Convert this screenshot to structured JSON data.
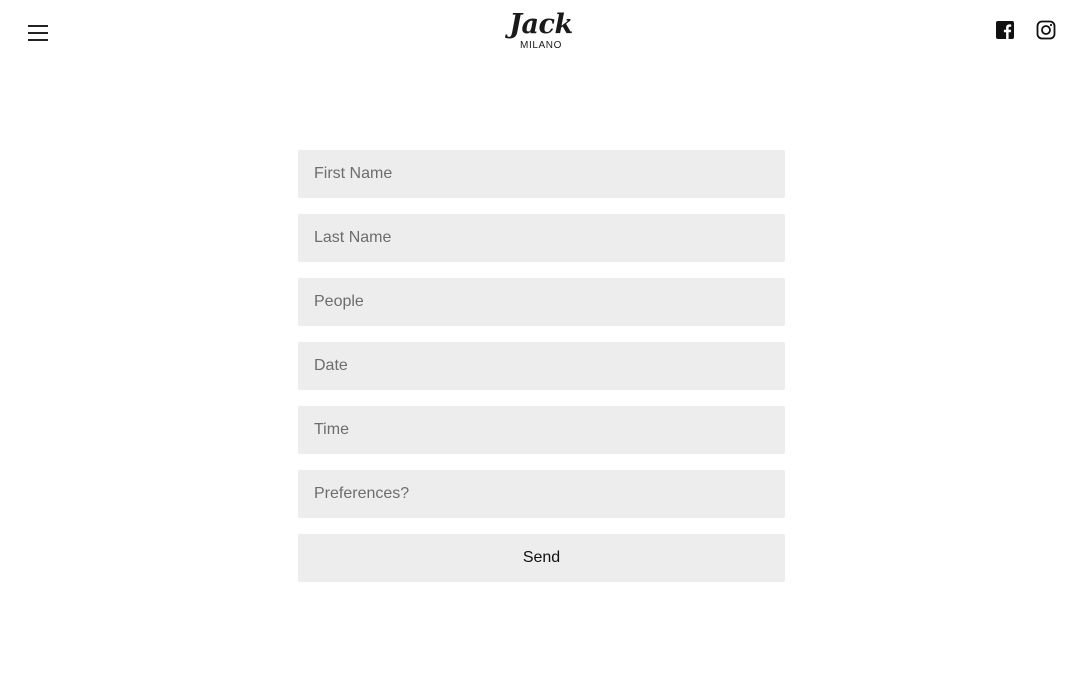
{
  "header": {
    "menu_icon": "hamburger-menu-icon",
    "logo": {
      "script": "Jack",
      "sub": "MILANO"
    },
    "social": [
      {
        "name": "facebook",
        "icon": "facebook-icon"
      },
      {
        "name": "instagram",
        "icon": "instagram-icon"
      }
    ]
  },
  "form": {
    "fields": [
      {
        "placeholder": "First Name",
        "value": ""
      },
      {
        "placeholder": "Last Name",
        "value": ""
      },
      {
        "placeholder": "People",
        "value": ""
      },
      {
        "placeholder": "Date",
        "value": ""
      },
      {
        "placeholder": "Time",
        "value": ""
      },
      {
        "placeholder": "Preferences?",
        "value": ""
      }
    ],
    "submit_label": "Send"
  },
  "colors": {
    "field_background": "#ededed",
    "page_background": "#ffffff",
    "text": "#1a1a1a"
  }
}
